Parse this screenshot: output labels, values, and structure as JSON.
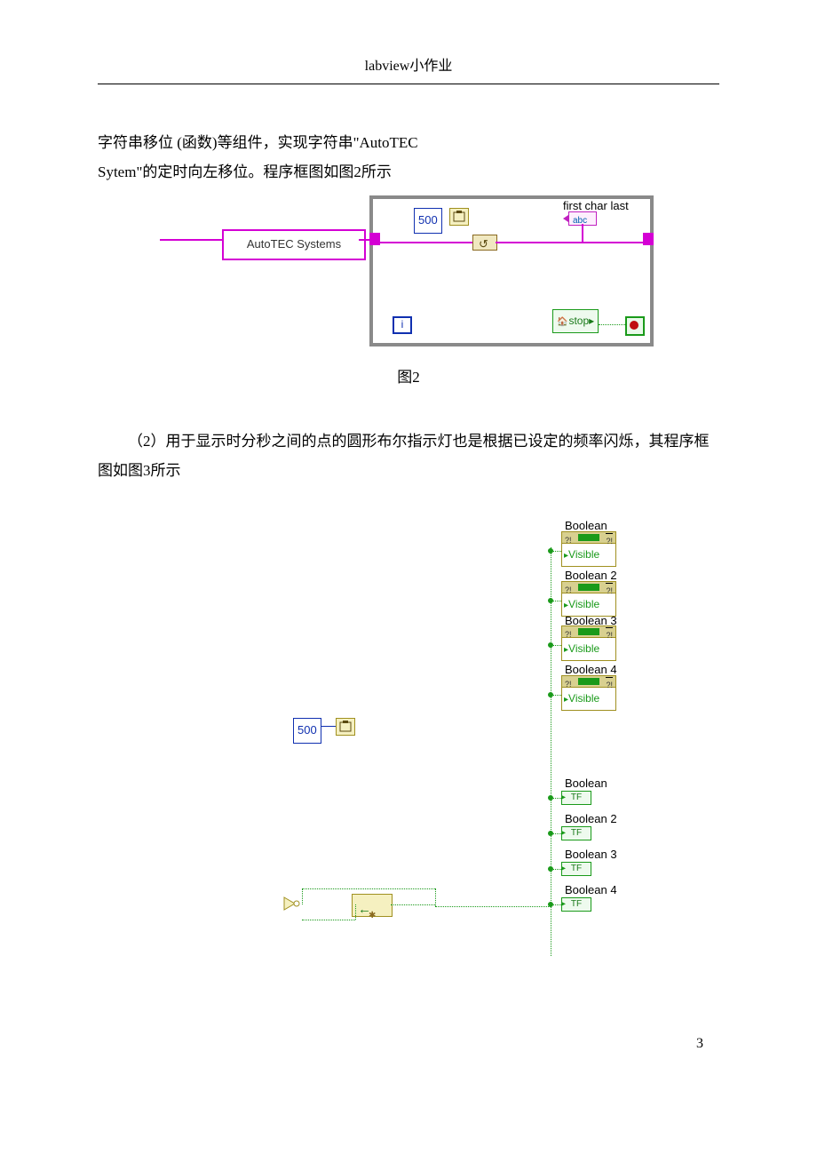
{
  "header": {
    "title": "labview小作业"
  },
  "body": {
    "p1_line1": "字符串移位 (函数)等组件，实现字符串\"AutoTEC",
    "p1_line2": "Sytem\"的定时向左移位。程序框图如图2所示",
    "fig2_caption": "图2",
    "p2": "（2）用于显示时分秒之间的点的圆形布尔指示灯也是根据已设定的频率闪烁，其程序框图如图3所示"
  },
  "fig2": {
    "str_const": "AutoTEC Systems",
    "wait_ms": "500",
    "indicator_label": "first char last",
    "iter": "i",
    "stop_label": "stop"
  },
  "fig3": {
    "wait_ms": "500",
    "visible": "Visible",
    "tf_text": "TF",
    "prop1": "Boolean",
    "prop2": "Boolean 2",
    "prop3": "Boolean 3",
    "prop4": "Boolean 4",
    "ind1": "Boolean",
    "ind2": "Boolean 2",
    "ind3": "Boolean 3",
    "ind4": "Boolean 4"
  },
  "page_number": "3"
}
